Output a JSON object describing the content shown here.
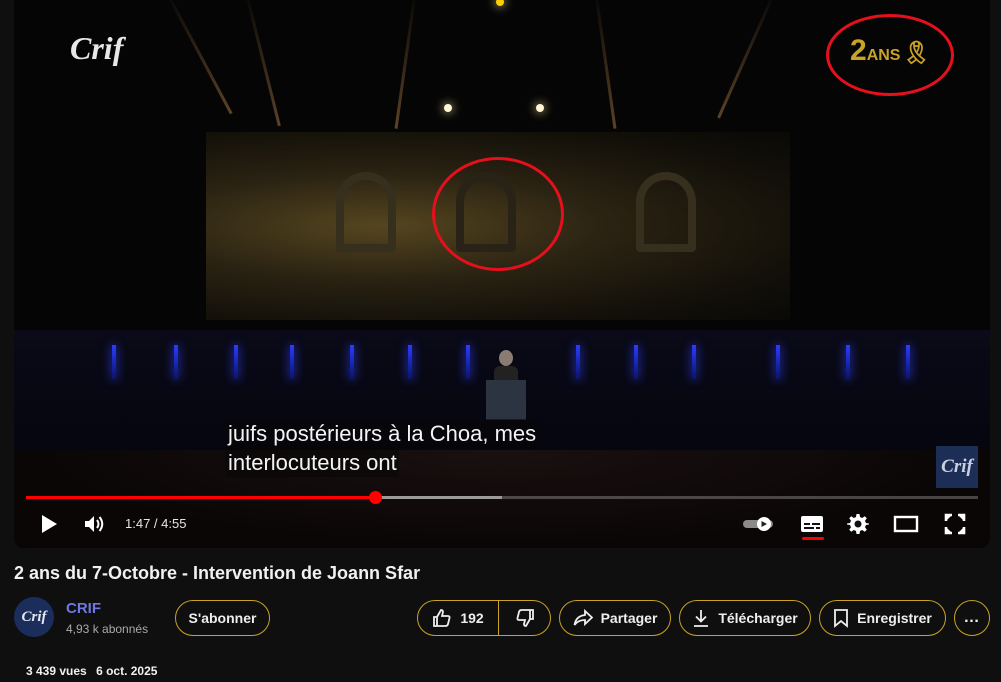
{
  "player": {
    "overlay_logo_text": "Crif",
    "anniversary_logo": {
      "number": "2",
      "word": "ANS",
      "ribbon": "ribbon-icon"
    },
    "watermark_text": "Crif",
    "subtitle_lines": [
      "juifs postérieurs à la Choa, mes",
      "interlocuteurs ont"
    ],
    "time_display": "1:47 / 4:55",
    "progress": {
      "played_fraction": 0.367,
      "buffered_fraction": 0.5
    },
    "controls": [
      "play-icon",
      "volume-icon",
      "autoplay-toggle",
      "subtitles-icon",
      "settings-icon",
      "theater-mode-icon",
      "fullscreen-icon"
    ],
    "annotation_color": "#e5101b",
    "accent_color": "#ff0000"
  },
  "video": {
    "title": "2 ans du 7-Octobre - Intervention de Joann Sfar",
    "views": "3 439 vues",
    "date": "6 oct. 2025"
  },
  "channel": {
    "avatar_text": "Crif",
    "name": "CRIF",
    "subscribers": "4,93 k abonnés",
    "subscribe_label": "S'abonner"
  },
  "actions": {
    "like_count": "192",
    "share_label": "Partager",
    "download_label": "Télécharger",
    "save_label": "Enregistrer",
    "more_label": "…",
    "border_color": "#c9a227"
  }
}
